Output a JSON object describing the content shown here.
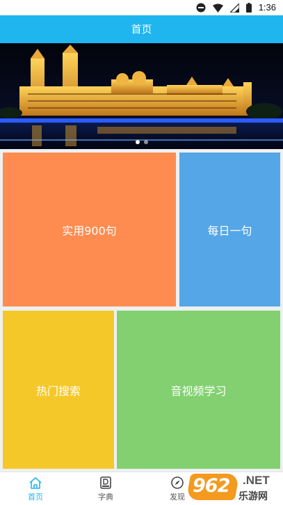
{
  "status_bar": {
    "time": "1:36",
    "icons": [
      "do-not-disturb-icon",
      "wifi-icon",
      "signal-icon",
      "battery-icon"
    ]
  },
  "header": {
    "title": "首页"
  },
  "banner": {
    "image": "night-palace-photo",
    "slide_count": 2,
    "active_slide": 1
  },
  "tiles": [
    {
      "label": "实用900句",
      "color": "#fe8c50"
    },
    {
      "label": "每日一句",
      "color": "#55a6e6"
    },
    {
      "label": "热门搜索",
      "color": "#f4c828"
    },
    {
      "label": "音视频学习",
      "color": "#82d070"
    }
  ],
  "bottom_nav": [
    {
      "label": "首页",
      "icon": "home-icon",
      "active": true
    },
    {
      "label": "字典",
      "icon": "dictionary-icon",
      "active": false
    },
    {
      "label": "发现",
      "icon": "compass-icon",
      "active": false
    }
  ],
  "watermark": {
    "number": "962",
    "suffix": ".NET",
    "text": "乐游网"
  },
  "colors": {
    "accent": "#1fb5ee",
    "nav_active": "#1fb5ee"
  }
}
